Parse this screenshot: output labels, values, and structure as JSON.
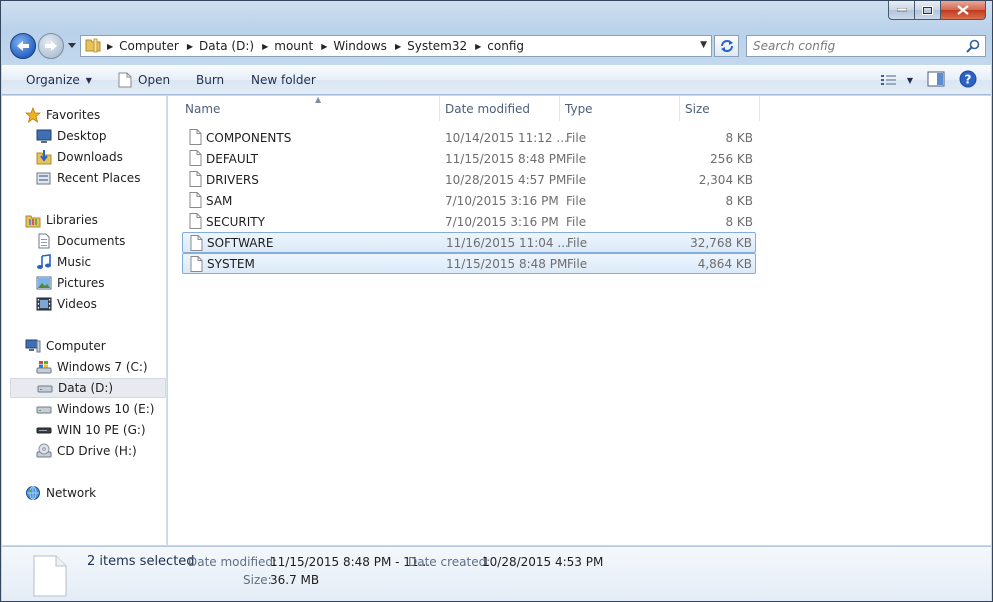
{
  "window": {
    "caption": {
      "minimize": "minimize",
      "maximize": "maximize",
      "close": "close"
    }
  },
  "address": {
    "crumbs": [
      "Computer",
      "Data (D:)",
      "mount",
      "Windows",
      "System32",
      "config"
    ],
    "search_placeholder": "Search config"
  },
  "toolbar": {
    "organize": "Organize",
    "open": "Open",
    "burn": "Burn",
    "new_folder": "New folder"
  },
  "nav": {
    "favorites": "Favorites",
    "desktop": "Desktop",
    "downloads": "Downloads",
    "recent_places": "Recent Places",
    "libraries": "Libraries",
    "documents": "Documents",
    "music": "Music",
    "pictures": "Pictures",
    "videos": "Videos",
    "computer": "Computer",
    "drive_c": "Windows 7 (C:)",
    "drive_d": "Data (D:)",
    "drive_e": "Windows 10 (E:)",
    "drive_g": "WIN 10 PE (G:)",
    "drive_h": "CD Drive (H:)",
    "network": "Network"
  },
  "columns": {
    "name": "Name",
    "date": "Date modified",
    "type": "Type",
    "size": "Size"
  },
  "files": [
    {
      "name": "COMPONENTS",
      "date": "10/14/2015 11:12 ...",
      "type": "File",
      "size": "8 KB",
      "selected": false
    },
    {
      "name": "DEFAULT",
      "date": "11/15/2015 8:48 PM",
      "type": "File",
      "size": "256 KB",
      "selected": false
    },
    {
      "name": "DRIVERS",
      "date": "10/28/2015 4:57 PM",
      "type": "File",
      "size": "2,304 KB",
      "selected": false
    },
    {
      "name": "SAM",
      "date": "7/10/2015 3:16 PM",
      "type": "File",
      "size": "8 KB",
      "selected": false
    },
    {
      "name": "SECURITY",
      "date": "7/10/2015 3:16 PM",
      "type": "File",
      "size": "8 KB",
      "selected": false
    },
    {
      "name": "SOFTWARE",
      "date": "11/16/2015 11:04 ...",
      "type": "File",
      "size": "32,768 KB",
      "selected": true
    },
    {
      "name": "SYSTEM",
      "date": "11/15/2015 8:48 PM",
      "type": "File",
      "size": "4,864 KB",
      "selected": true
    }
  ],
  "details": {
    "count": "2 items selected",
    "date_modified_label": "Date modified:",
    "date_modified_value": "11/15/2015 8:48 PM - 11...",
    "date_created_label": "Date created:",
    "date_created_value": "10/28/2015 4:53 PM",
    "size_label": "Size:",
    "size_value": "36.7 MB"
  },
  "colors": {
    "selection_border": "#84acdd",
    "selection_fill": "#dbe9f8",
    "accent": "#2a63c4"
  }
}
